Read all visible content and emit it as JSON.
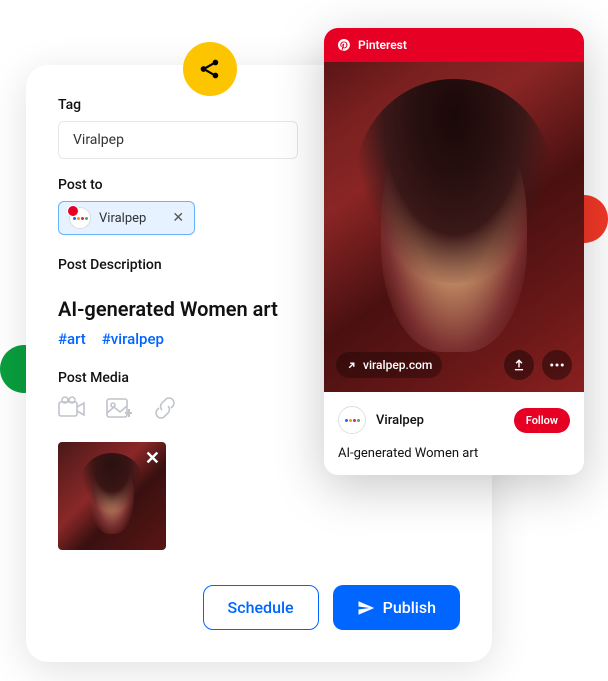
{
  "main": {
    "tag_label": "Tag",
    "tag_value": "Viralpep",
    "postto_label": "Post to",
    "postto_chip": "Viralpep",
    "desc_label": "Post Description",
    "desc_title": "AI-generated Women art",
    "hashtags": [
      "#art",
      "#viralpep"
    ],
    "media_label": "Post Media",
    "schedule_label": "Schedule",
    "publish_label": "Publish"
  },
  "preview": {
    "platform": "Pinterest",
    "link": "viralpep.com",
    "account": "Viralpep",
    "follow": "Follow",
    "desc": "AI-generated Women art"
  }
}
